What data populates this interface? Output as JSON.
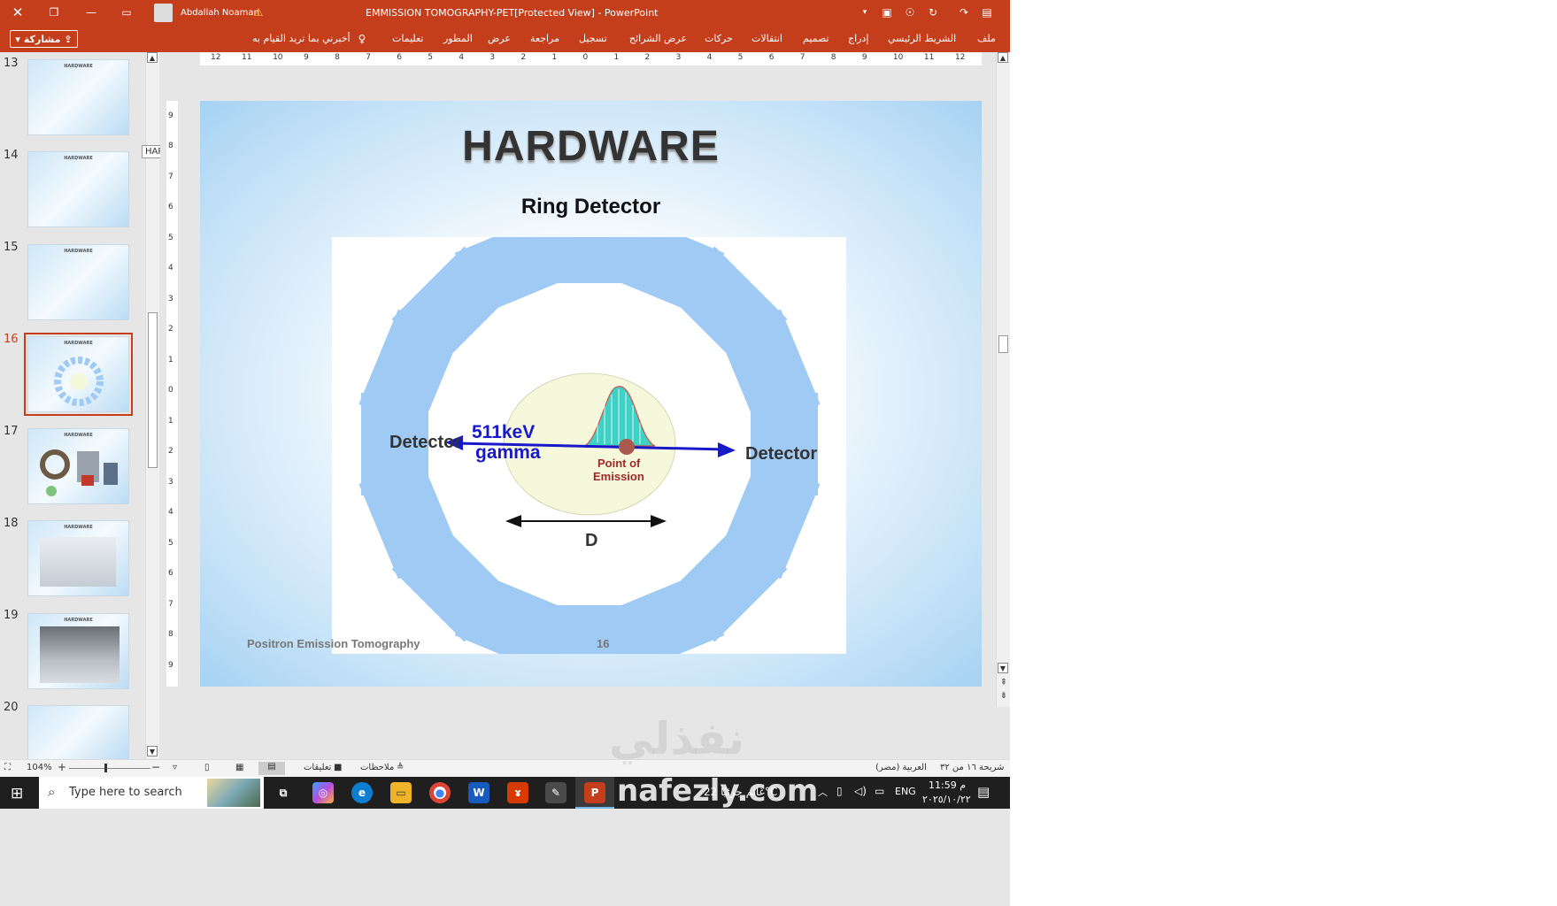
{
  "window": {
    "title": "EMMISSION TOMOGRAPHY-PET[Protected View] - PowerPoint",
    "user": "Abdallah Noaman",
    "share_label": "مشاركة"
  },
  "ribbon": {
    "tabs": [
      "ملف",
      "الشريط الرئيسي",
      "إدراج",
      "تصميم",
      "انتقالات",
      "حركات",
      "عرض الشرائح",
      "تسجيل",
      "مراجعة",
      "عرض",
      "المطور",
      "تعليمات"
    ],
    "tell_me": "أخبرني بما تريد القيام به"
  },
  "thumbnails": {
    "items": [
      {
        "num": "13",
        "title": "HARDWARE"
      },
      {
        "num": "14",
        "title": "HARDWARE"
      },
      {
        "num": "15",
        "title": "HARDWARE"
      },
      {
        "num": "16",
        "title": "HARDWARE"
      },
      {
        "num": "17",
        "title": "HARDWARE"
      },
      {
        "num": "18",
        "title": "HARDWARE"
      },
      {
        "num": "19",
        "title": "HARDWARE"
      },
      {
        "num": "20",
        "title": ""
      }
    ],
    "selected": "16",
    "tooltip": "HARDWARE"
  },
  "ruler": {
    "h_ticks": [
      "12",
      "11",
      "10",
      "9",
      "8",
      "7",
      "6",
      "5",
      "4",
      "3",
      "2",
      "1",
      "0",
      "1",
      "2",
      "3",
      "4",
      "5",
      "6",
      "7",
      "8",
      "9",
      "10",
      "11",
      "12"
    ],
    "v_ticks": [
      "9",
      "8",
      "7",
      "6",
      "5",
      "4",
      "3",
      "2",
      "1",
      "0",
      "1",
      "2",
      "3",
      "4",
      "5",
      "6",
      "7",
      "8",
      "9"
    ]
  },
  "slide": {
    "title": "HARDWARE",
    "subtitle": "Ring Detector",
    "diagram": {
      "left_label": "Detector",
      "right_label": "Detector",
      "energy": "511keV",
      "gamma": "gamma",
      "point_line1": "Point of",
      "point_line2": "Emission",
      "diameter": "D"
    },
    "footer_left": "Positron Emission Tomography",
    "footer_num": "16"
  },
  "status": {
    "zoom": "104%",
    "comments": "تعليقات",
    "notes": "ملاحظات",
    "language": "العربية (مصر)",
    "slide_info": "شريحة ١٦ من ٣٢"
  },
  "taskbar": {
    "search_placeholder": "Type here to search",
    "weather": "غائم جزئيًا 22°C",
    "lang": "ENG",
    "time": "11:59 م",
    "date": "٢٠٢٥/١٠/٢٢"
  },
  "watermark": {
    "arabic": "نفذلي",
    "latin": "nafezly.com"
  },
  "colors": {
    "accent": "#c43e1c",
    "detector": "#9fcaf3",
    "arrow": "#1818c8"
  }
}
